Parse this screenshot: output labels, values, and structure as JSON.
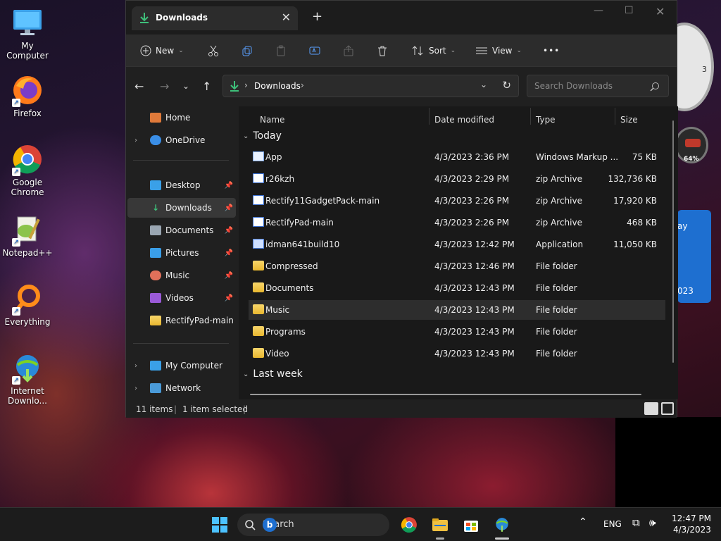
{
  "desktop": {
    "icons": [
      {
        "label": "My Computer"
      },
      {
        "label": "Firefox"
      },
      {
        "label": "Google Chrome"
      },
      {
        "label": "Notepad++"
      },
      {
        "label": "Everything"
      },
      {
        "label": "Internet Downlo..."
      }
    ]
  },
  "widgets": {
    "clock_number": "3",
    "meter_percent": "64%",
    "calendar_partial_day": "ay",
    "calendar_partial_year": "023"
  },
  "window": {
    "tab_title": "Downloads",
    "toolbar": {
      "new_label": "New",
      "sort_label": "Sort",
      "view_label": "View",
      "more_label": "•••"
    },
    "address": {
      "path_item": "Downloads",
      "search_placeholder": "Search Downloads"
    },
    "sidebar": {
      "items": [
        {
          "label": "Home"
        },
        {
          "label": "OneDrive"
        },
        {
          "label": "Desktop"
        },
        {
          "label": "Downloads"
        },
        {
          "label": "Documents"
        },
        {
          "label": "Pictures"
        },
        {
          "label": "Music"
        },
        {
          "label": "Videos"
        },
        {
          "label": "RectifyPad-main"
        },
        {
          "label": "My Computer"
        },
        {
          "label": "Network"
        }
      ]
    },
    "columns": {
      "name": "Name",
      "date": "Date modified",
      "type": "Type",
      "size": "Size"
    },
    "groups": {
      "today": "Today",
      "last_week": "Last week"
    },
    "files": [
      {
        "name": "App",
        "date": "4/3/2023 2:36 PM",
        "type": "Windows Markup ...",
        "size": "75 KB"
      },
      {
        "name": "r26kzh",
        "date": "4/3/2023 2:29 PM",
        "type": "zip Archive",
        "size": "132,736 KB"
      },
      {
        "name": "Rectify11GadgetPack-main",
        "date": "4/3/2023 2:26 PM",
        "type": "zip Archive",
        "size": "17,920 KB"
      },
      {
        "name": "RectifyPad-main",
        "date": "4/3/2023 2:26 PM",
        "type": "zip Archive",
        "size": "468 KB"
      },
      {
        "name": "idman641build10",
        "date": "4/3/2023 12:42 PM",
        "type": "Application",
        "size": "11,050 KB"
      },
      {
        "name": "Compressed",
        "date": "4/3/2023 12:46 PM",
        "type": "File folder",
        "size": ""
      },
      {
        "name": "Documents",
        "date": "4/3/2023 12:43 PM",
        "type": "File folder",
        "size": ""
      },
      {
        "name": "Music",
        "date": "4/3/2023 12:43 PM",
        "type": "File folder",
        "size": ""
      },
      {
        "name": "Programs",
        "date": "4/3/2023 12:43 PM",
        "type": "File folder",
        "size": ""
      },
      {
        "name": "Video",
        "date": "4/3/2023 12:43 PM",
        "type": "File folder",
        "size": ""
      }
    ],
    "status": {
      "items_count": "11 items",
      "selected": "1 item selected"
    }
  },
  "taskbar": {
    "search_label": "Search",
    "language": "ENG",
    "time": "12:47 PM",
    "date": "4/3/2023"
  }
}
